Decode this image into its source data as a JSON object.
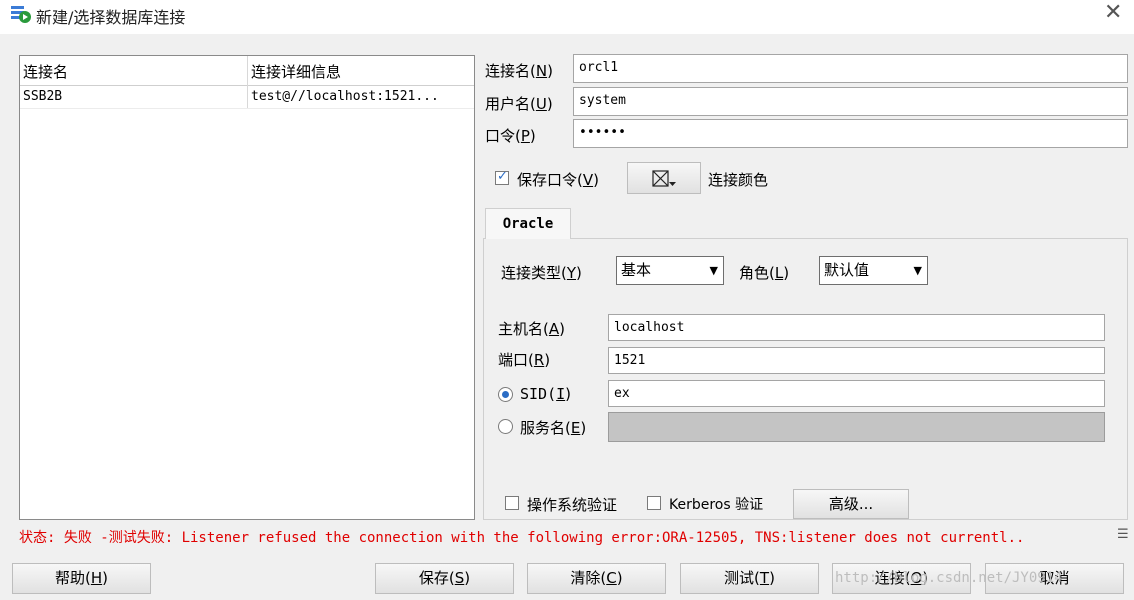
{
  "window": {
    "title": "新建/选择数据库连接"
  },
  "connection_list": {
    "columns": [
      "连接名",
      "连接详细信息"
    ],
    "rows": [
      {
        "name": "SSB2B",
        "details": "test@//localhost:1521..."
      }
    ]
  },
  "form": {
    "conn_name_label": "连接名(",
    "conn_name_key": "N",
    "conn_name_value": "orcl1",
    "user_label": "用户名(",
    "user_key": "U",
    "user_value": "system",
    "password_label": "口令(",
    "password_key": "P",
    "password_value": "••••••",
    "save_password_label": "保存口令(",
    "save_password_key": "V",
    "conn_color_label": "连接颜色"
  },
  "tab": {
    "label": "Oracle"
  },
  "oracle": {
    "conn_type_label": "连接类型(",
    "conn_type_key": "Y",
    "conn_type_value": "基本",
    "role_label": "角色(",
    "role_key": "L",
    "role_value": "默认值",
    "host_label": "主机名(",
    "host_key": "A",
    "host_value": "localhost",
    "port_label": "端口(",
    "port_key": "R",
    "port_value": "1521",
    "sid_label": "SID(",
    "sid_key": "I",
    "sid_value": "ex",
    "service_label": "服务名(",
    "service_key": "E",
    "os_auth_label": "操作系统验证",
    "kerberos_label": "Kerberos 验证",
    "advanced_label": "高级..."
  },
  "status": {
    "text": "状态: 失败 -测试失败: Listener refused the connection with the following error:ORA-12505, TNS:listener does not currentl.."
  },
  "buttons": {
    "help": "帮助(",
    "help_key": "H",
    "save": "保存(",
    "save_key": "S",
    "clear": "清除(",
    "clear_key": "C",
    "test": "测试(",
    "test_key": "T",
    "connect": "连接(",
    "connect_key": "O",
    "cancel": "取消"
  },
  "watermark": "http://blog.csdn.net/JY0914",
  "icons": {
    "title": "db-connect-icon",
    "close": "close-icon",
    "color_picker": "color-picker-icon",
    "status": "details-icon"
  },
  "colors": {
    "status_error": "#e00000",
    "accent": "#2b6cc4"
  }
}
